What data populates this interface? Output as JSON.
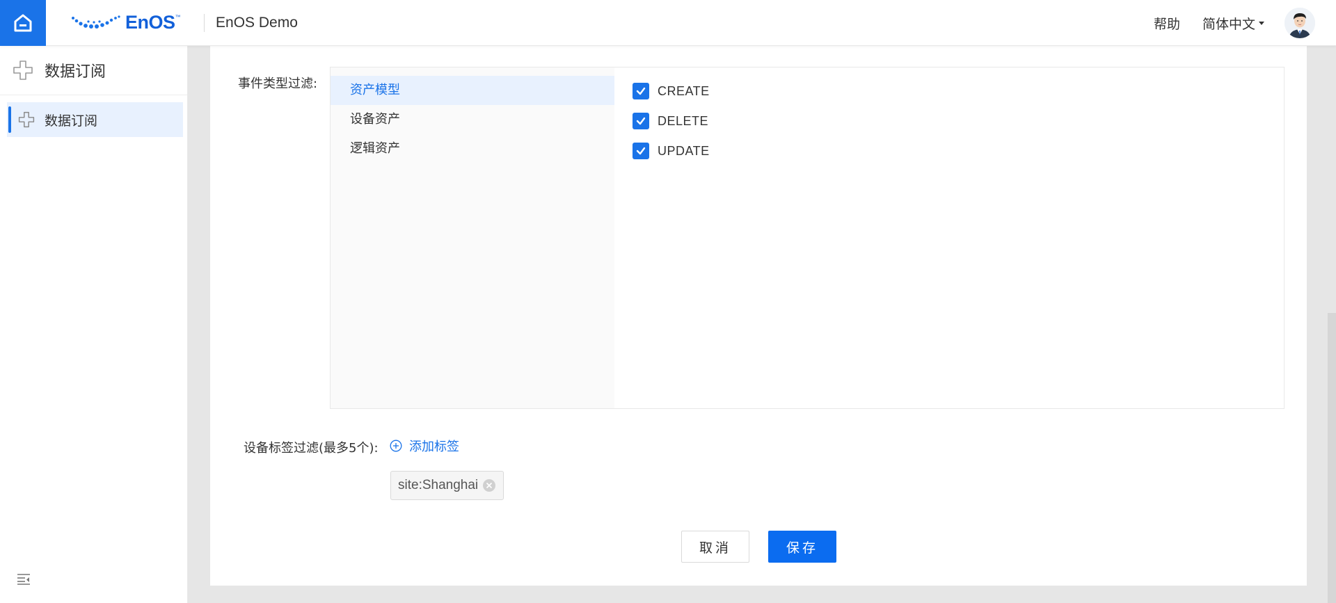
{
  "header": {
    "logo_text": "EnOS",
    "logo_tm": "™",
    "app_title": "EnOS Demo",
    "help_label": "帮助",
    "language_label": "简体中文",
    "accent_color": "#1a73e8"
  },
  "sidebar": {
    "title": "数据订阅",
    "items": [
      {
        "label": "数据订阅",
        "active": true,
        "icon": "plus-cross-icon"
      }
    ],
    "collapse_icon": "collapse-menu-icon"
  },
  "form": {
    "event_filter_label": "事件类型过滤:",
    "event_categories": [
      {
        "label": "资产模型",
        "active": true
      },
      {
        "label": "设备资产",
        "active": false
      },
      {
        "label": "逻辑资产",
        "active": false
      }
    ],
    "event_types": [
      {
        "label": "CREATE",
        "checked": true
      },
      {
        "label": "DELETE",
        "checked": true
      },
      {
        "label": "UPDATE",
        "checked": true
      }
    ],
    "tag_filter_label": "设备标签过滤(最多5个):",
    "add_tag_label": "添加标签",
    "tags": [
      "site:Shanghai"
    ],
    "cancel_label": "取消",
    "save_label": "保存"
  }
}
